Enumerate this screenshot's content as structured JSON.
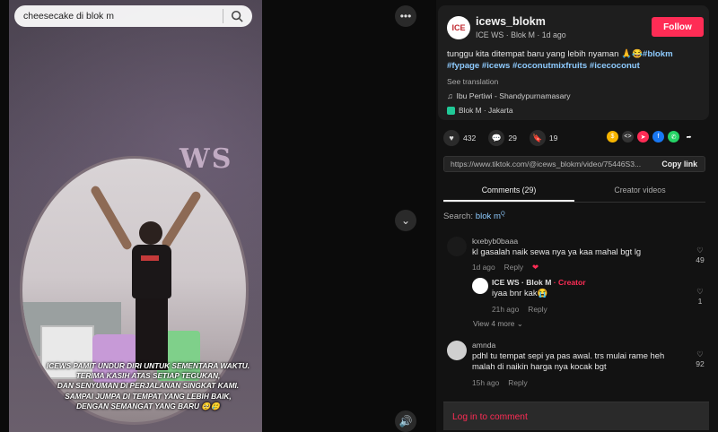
{
  "search": {
    "query": "cheesecake di blok m"
  },
  "video": {
    "sign_text": "WS",
    "overlay_caption": [
      "ICEWS PAMIT UNDUR DIRI UNTUK SEMENTARA WAKTU.",
      "TERIMA KASIH ATAS SETIAP TEGUKAN,",
      "DAN SENYUMAN DI PERJALANAN SINGKAT KAMI.",
      "SAMPAI JUMPA DI TEMPAT YANG LEBIH BAIK,",
      "DENGAN SEMANGAT YANG BARU 🥺🥲"
    ]
  },
  "post": {
    "username": "icews_blokm",
    "avatar_text": "ICE",
    "subline": "ICE WS · Blok M · 1d ago",
    "follow_label": "Follow",
    "description": "tunggu kita ditempat baru yang lebih nyaman 🙏😂",
    "hashtags_line1": "#blokm",
    "hashtags_line2": "#fypage #icews #coconutmixfruits #icecoconut",
    "see_translation": "See translation",
    "music": "Ibu Pertiwi - Shandypurnamasary",
    "location": "Blok M · Jakarta"
  },
  "actions": {
    "likes": "432",
    "comments": "29",
    "saves": "19"
  },
  "link": {
    "url": "https://www.tiktok.com/@icews_blokm/video/75446S3...",
    "copy_label": "Copy link"
  },
  "tabs": [
    {
      "label": "Comments (29)"
    },
    {
      "label": "Creator videos"
    }
  ],
  "comment_search": {
    "prefix": "Search:",
    "term": "blok m"
  },
  "comments": [
    {
      "name": "kxebyb0baaa",
      "text": "kl gasalah naik sewa nya ya kaa mahal bgt lg",
      "time": "1d ago",
      "reply": "Reply",
      "likes": "49"
    },
    {
      "name": "ICE WS · Blok M",
      "creator_tag": " · Creator",
      "text": "iyaa bnr kak😭",
      "time": "21h ago",
      "reply": "Reply",
      "likes": "1"
    },
    {
      "name": "amnda",
      "text": "pdhl tu tempat sepi ya pas awal. trs mulai rame heh malah di naikin harga nya kocak bgt",
      "time": "15h ago",
      "reply": "Reply",
      "likes": "92"
    }
  ],
  "view_more": "View 4 more",
  "login_label": "Log in to comment"
}
